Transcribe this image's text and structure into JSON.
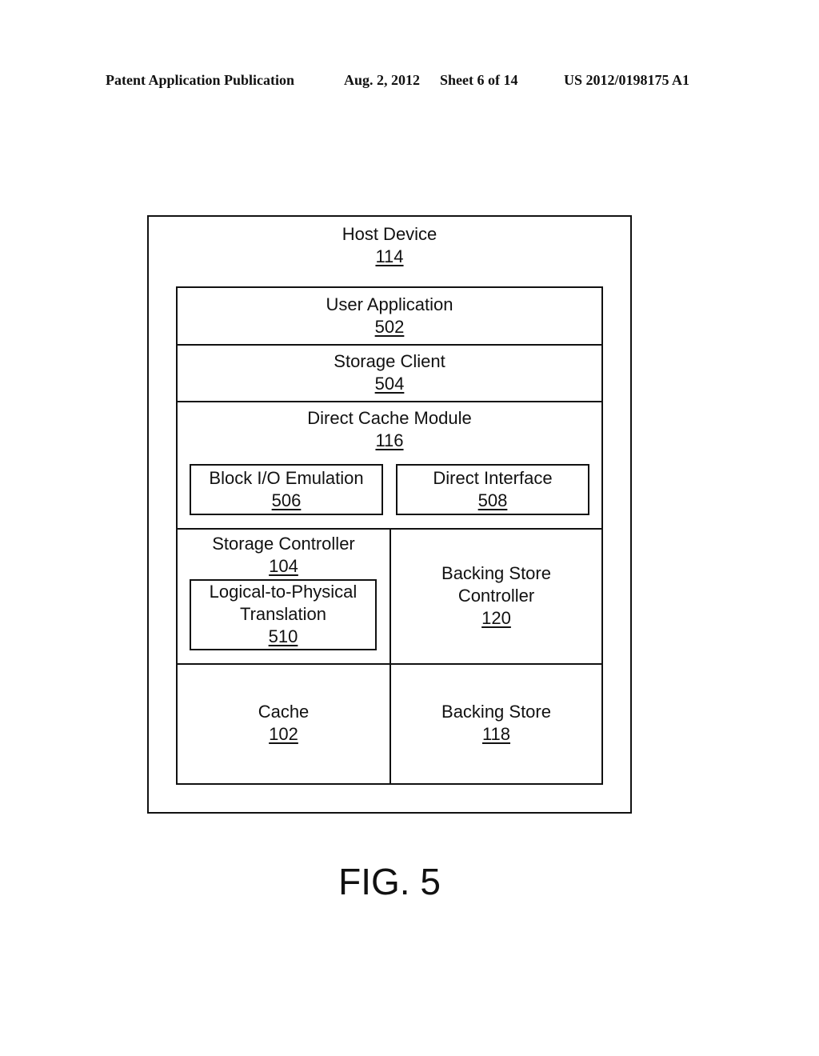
{
  "header": {
    "publication": "Patent Application Publication",
    "date": "Aug. 2, 2012",
    "sheet": "Sheet 6 of 14",
    "patent_number": "US 2012/0198175 A1"
  },
  "diagram": {
    "host": {
      "label": "Host Device",
      "ref": "114"
    },
    "user_application": {
      "label": "User Application",
      "ref": "502"
    },
    "storage_client": {
      "label": "Storage Client",
      "ref": "504"
    },
    "direct_cache_module": {
      "label": "Direct Cache Module",
      "ref": "116"
    },
    "block_io_emulation": {
      "label": "Block I/O Emulation",
      "ref": "506"
    },
    "direct_interface": {
      "label": "Direct Interface",
      "ref": "508"
    },
    "storage_controller": {
      "label": "Storage Controller",
      "ref": "104"
    },
    "l2p_translation": {
      "label_line1": "Logical-to-Physical",
      "label_line2": "Translation",
      "ref": "510"
    },
    "backing_store_controller": {
      "label_line1": "Backing Store",
      "label_line2": "Controller",
      "ref": "120"
    },
    "cache": {
      "label": "Cache",
      "ref": "102"
    },
    "backing_store": {
      "label": "Backing Store",
      "ref": "118"
    }
  },
  "figure_label": "FIG. 5"
}
